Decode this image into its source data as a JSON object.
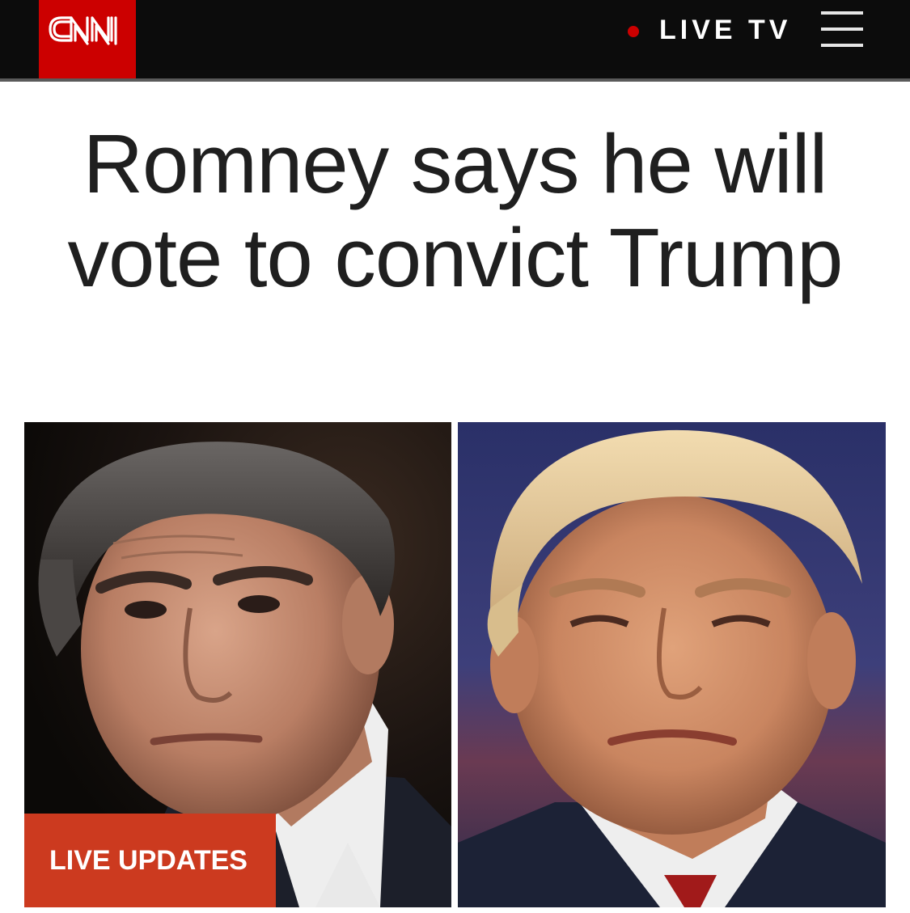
{
  "header": {
    "logo_text": "CNN",
    "live_label": "LIVE TV",
    "menu_icon": "hamburger-menu-icon"
  },
  "article": {
    "headline": "Romney says he will vote to convict Trump",
    "badge_label": "LIVE UPDATES"
  },
  "colors": {
    "brand_red": "#cc0000",
    "badge_red": "#cc3a1f",
    "topbar": "#0c0c0c"
  }
}
